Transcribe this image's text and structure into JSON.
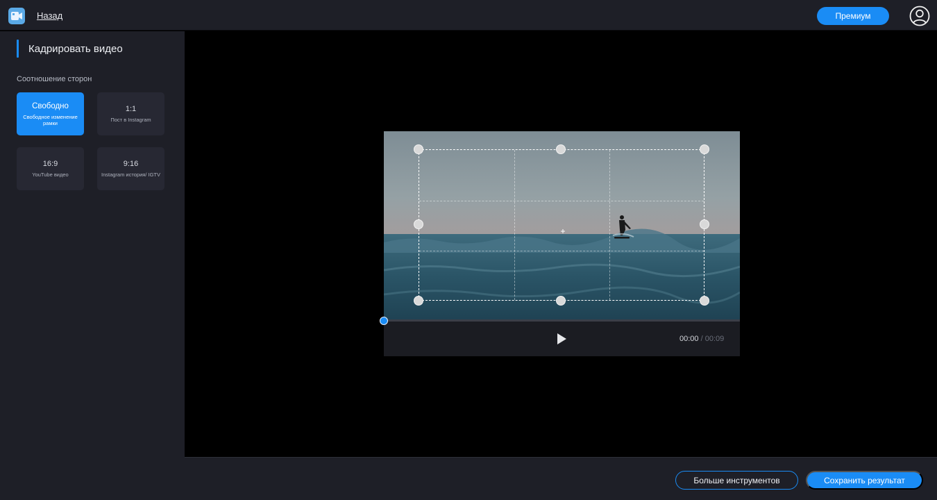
{
  "header": {
    "back_label": "Назад",
    "premium_label": "Премиум"
  },
  "sidebar": {
    "title": "Кадрировать видео",
    "ratio_heading": "Соотношение сторон",
    "ratios": [
      {
        "label": "Свободно",
        "sub": "Свободное изменение рамки",
        "selected": true
      },
      {
        "label": "1:1",
        "sub": "Пост в Instagram",
        "selected": false
      },
      {
        "label": "16:9",
        "sub": "YouTube видео",
        "selected": false
      },
      {
        "label": "9:16",
        "sub": "Instagram история/ IGTV",
        "selected": false
      }
    ]
  },
  "player": {
    "current_time": "00:00",
    "separator": "/",
    "duration": "00:09",
    "progress": 0
  },
  "footer": {
    "more_tools_label": "Больше инструментов",
    "save_label": "Сохранить результат"
  },
  "colors": {
    "accent": "#1a8cf5",
    "panel": "#1e1f27",
    "stage": "#000000"
  },
  "icons": {
    "logo": "app-logo-icon",
    "user": "user-avatar-icon",
    "play": "play-icon"
  }
}
